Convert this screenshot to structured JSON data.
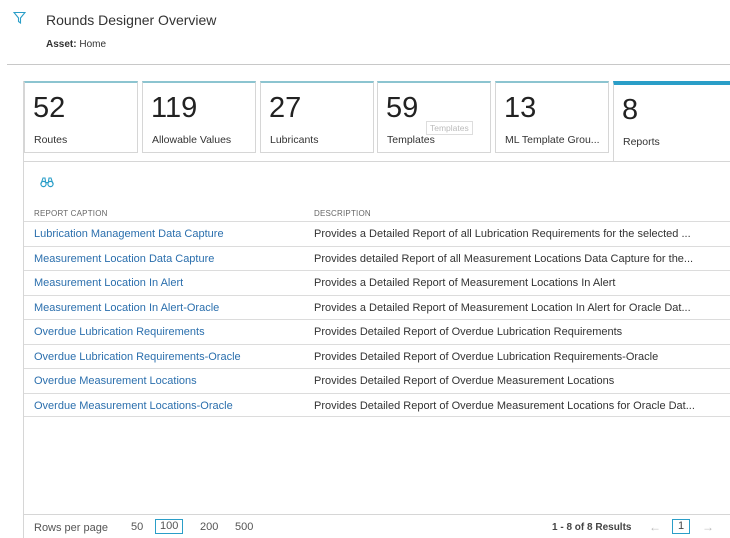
{
  "header": {
    "title": "Rounds Designer Overview",
    "asset_label": "Asset:",
    "asset_value": "Home"
  },
  "tiles": [
    {
      "number": "52",
      "label": "Routes"
    },
    {
      "number": "119",
      "label": "Allowable Values"
    },
    {
      "number": "27",
      "label": "Lubricants"
    },
    {
      "number": "59",
      "label": "Templates",
      "tooltip": "Templates"
    },
    {
      "number": "13",
      "label": "ML Template Grou..."
    },
    {
      "number": "8",
      "label": "Reports"
    }
  ],
  "table": {
    "columns": {
      "caption": "REPORT CAPTION",
      "description": "DESCRIPTION"
    },
    "rows": [
      {
        "caption": "Lubrication Management Data Capture",
        "description": "Provides a Detailed Report of all Lubrication Requirements for the selected ..."
      },
      {
        "caption": "Measurement Location Data Capture",
        "description": "Provides detailed Report of all Measurement Locations Data Capture for the..."
      },
      {
        "caption": "Measurement Location In Alert",
        "description": "Provides a Detailed Report of Measurement Locations In Alert"
      },
      {
        "caption": "Measurement Location In Alert-Oracle",
        "description": "Provides a Detailed Report of Measurement Location In Alert for Oracle Dat..."
      },
      {
        "caption": "Overdue Lubrication Requirements",
        "description": "Provides Detailed Report of Overdue Lubrication Requirements"
      },
      {
        "caption": "Overdue Lubrication Requirements-Oracle",
        "description": "Provides Detailed Report of Overdue Lubrication Requirements-Oracle"
      },
      {
        "caption": "Overdue Measurement Locations",
        "description": "Provides Detailed Report of Overdue Measurement Locations"
      },
      {
        "caption": "Overdue Measurement Locations-Oracle",
        "description": "Provides Detailed Report of Overdue Measurement Locations for Oracle Dat..."
      }
    ]
  },
  "footer": {
    "rows_per_page_label": "Rows per page",
    "options": [
      "50",
      "100",
      "200",
      "500"
    ],
    "selected_option": "100",
    "results": "1 - 8 of 8 Results",
    "current_page": "1",
    "prev_icon": "arrow-left-icon",
    "next_icon": "arrow-right-icon"
  },
  "colors": {
    "accent": "#2a9ec8",
    "link": "#2b6fad"
  }
}
